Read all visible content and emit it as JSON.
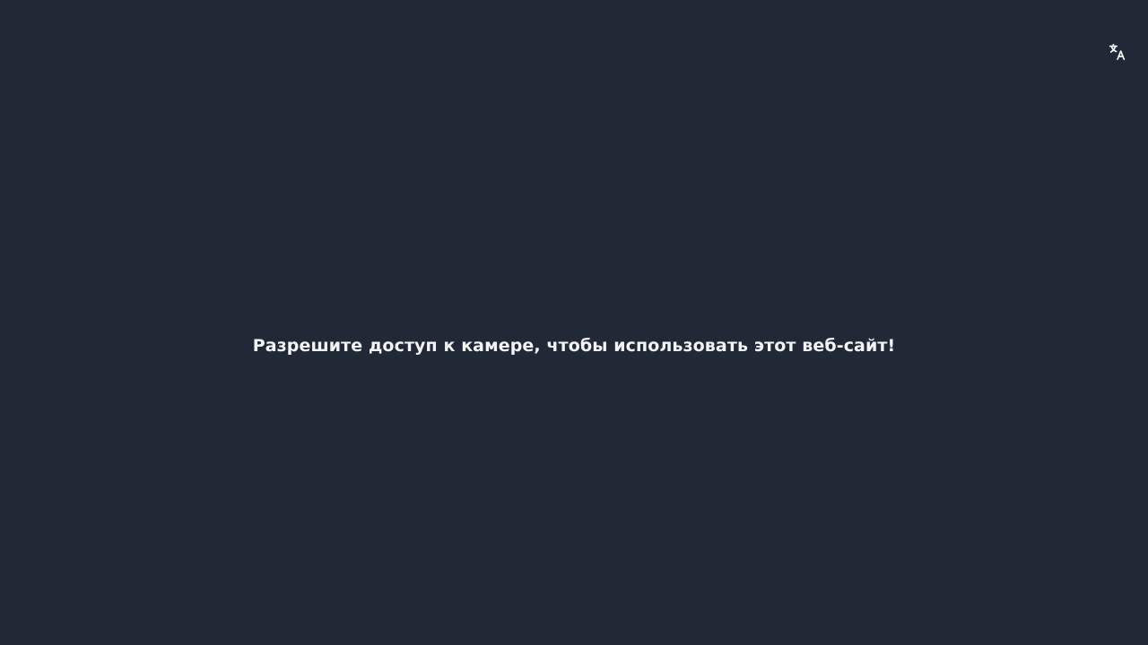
{
  "colors": {
    "background": "#212937",
    "text": "#f3f4f6",
    "icon": "#ffffff"
  },
  "toolbar": {
    "translate_icon": "translate-icon"
  },
  "main": {
    "message": "Разрешите доступ к камере, чтобы использовать этот веб-сайт!"
  }
}
